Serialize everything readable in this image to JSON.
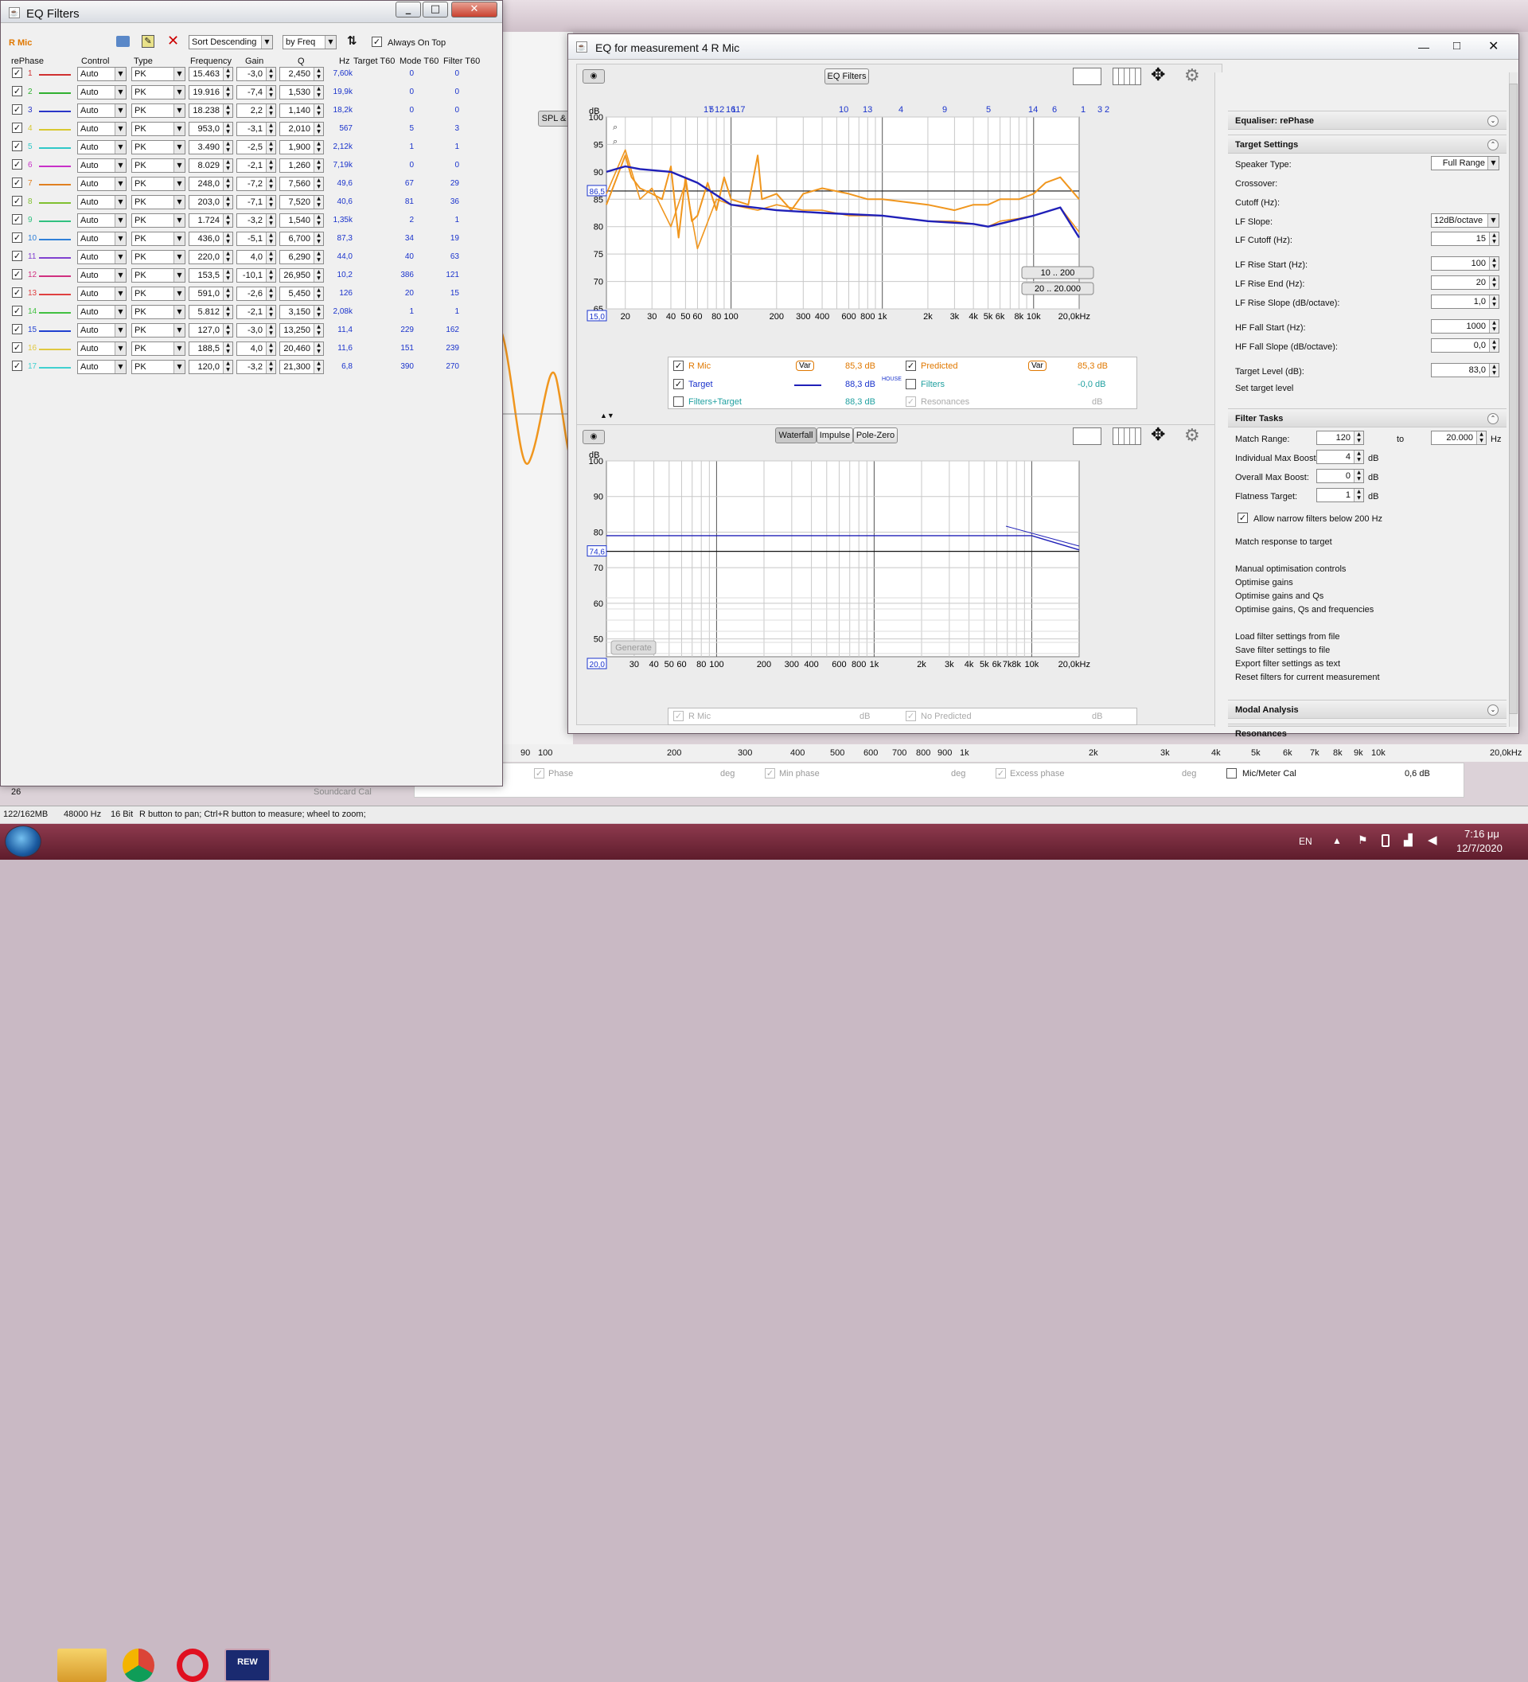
{
  "eq_filters": {
    "title": "EQ Filters",
    "measurement": "R Mic",
    "sort_select": "Sort Descending",
    "sort_by": "by Freq",
    "always_on_top": "Always On Top",
    "headers": {
      "filter": "rePhase",
      "control": "Control",
      "type": "Type",
      "frequency": "Frequency",
      "gain": "Gain",
      "q": "Q",
      "hz": "Hz",
      "target_t60": "Target T60",
      "mode_t60": "Mode T60",
      "filter_t60": "Filter T60"
    },
    "filters": [
      {
        "n": "1",
        "control": "Auto",
        "type": "PK",
        "freq": "15.463",
        "gain": "-3,0",
        "q": "2,450",
        "hz": "7,60k",
        "mode": "0",
        "filt": "0",
        "color": "#d03030"
      },
      {
        "n": "2",
        "control": "Auto",
        "type": "PK",
        "freq": "19.916",
        "gain": "-7,4",
        "q": "1,530",
        "hz": "19,9k",
        "mode": "0",
        "filt": "0",
        "color": "#30b030"
      },
      {
        "n": "3",
        "control": "Auto",
        "type": "PK",
        "freq": "18.238",
        "gain": "2,2",
        "q": "1,140",
        "hz": "18,2k",
        "mode": "0",
        "filt": "0",
        "color": "#2a36c8"
      },
      {
        "n": "4",
        "control": "Auto",
        "type": "PK",
        "freq": "953,0",
        "gain": "-3,1",
        "q": "2,010",
        "hz": "567",
        "mode": "5",
        "filt": "3",
        "color": "#d8c830"
      },
      {
        "n": "5",
        "control": "Auto",
        "type": "PK",
        "freq": "3.490",
        "gain": "-2,5",
        "q": "1,900",
        "hz": "2,12k",
        "mode": "1",
        "filt": "1",
        "color": "#30c8c8"
      },
      {
        "n": "6",
        "control": "Auto",
        "type": "PK",
        "freq": "8.029",
        "gain": "-2,1",
        "q": "1,260",
        "hz": "7,19k",
        "mode": "0",
        "filt": "0",
        "color": "#c830c8"
      },
      {
        "n": "7",
        "control": "Auto",
        "type": "PK",
        "freq": "248,0",
        "gain": "-7,2",
        "q": "7,560",
        "hz": "49,6",
        "mode": "67",
        "filt": "29",
        "color": "#e08020"
      },
      {
        "n": "8",
        "control": "Auto",
        "type": "PK",
        "freq": "203,0",
        "gain": "-7,1",
        "q": "7,520",
        "hz": "40,6",
        "mode": "81",
        "filt": "36",
        "color": "#80c030"
      },
      {
        "n": "9",
        "control": "Auto",
        "type": "PK",
        "freq": "1.724",
        "gain": "-3,2",
        "q": "1,540",
        "hz": "1,35k",
        "mode": "2",
        "filt": "1",
        "color": "#30c080"
      },
      {
        "n": "10",
        "control": "Auto",
        "type": "PK",
        "freq": "436,0",
        "gain": "-5,1",
        "q": "6,700",
        "hz": "87,3",
        "mode": "34",
        "filt": "19",
        "color": "#3080d8"
      },
      {
        "n": "11",
        "control": "Auto",
        "type": "PK",
        "freq": "220,0",
        "gain": "4,0",
        "q": "6,290",
        "hz": "44,0",
        "mode": "40",
        "filt": "63",
        "color": "#8040d0"
      },
      {
        "n": "12",
        "control": "Auto",
        "type": "PK",
        "freq": "153,5",
        "gain": "-10,1",
        "q": "26,950",
        "hz": "10,2",
        "mode": "386",
        "filt": "121",
        "color": "#d03080"
      },
      {
        "n": "13",
        "control": "Auto",
        "type": "PK",
        "freq": "591,0",
        "gain": "-2,6",
        "q": "5,450",
        "hz": "126",
        "mode": "20",
        "filt": "15",
        "color": "#e04040"
      },
      {
        "n": "14",
        "control": "Auto",
        "type": "PK",
        "freq": "5.812",
        "gain": "-2,1",
        "q": "3,150",
        "hz": "2,08k",
        "mode": "1",
        "filt": "1",
        "color": "#40c040"
      },
      {
        "n": "15",
        "control": "Auto",
        "type": "PK",
        "freq": "127,0",
        "gain": "-3,0",
        "q": "13,250",
        "hz": "11,4",
        "mode": "229",
        "filt": "162",
        "color": "#2040d0"
      },
      {
        "n": "16",
        "control": "Auto",
        "type": "PK",
        "freq": "188,5",
        "gain": "4,0",
        "q": "20,460",
        "hz": "11,6",
        "mode": "151",
        "filt": "239",
        "color": "#e0c840"
      },
      {
        "n": "17",
        "control": "Auto",
        "type": "PK",
        "freq": "120,0",
        "gain": "-3,2",
        "q": "21,300",
        "hz": "6,8",
        "mode": "390",
        "filt": "270",
        "color": "#40d0d0"
      }
    ]
  },
  "eq_window": {
    "title": "EQ for measurement 4 R Mic",
    "eq_filters_button": "EQ Filters",
    "top_axis_labels": [
      "17",
      "5",
      "12",
      "16",
      "117",
      "10",
      "13",
      "4",
      "9",
      "5",
      "14",
      "6",
      "1",
      "3",
      "2"
    ],
    "y_unit": "dB",
    "y_ticks": [
      "100",
      "95",
      "90",
      "85",
      "80",
      "75",
      "70",
      "65"
    ],
    "y_marker": "86,5",
    "x_start": "15,0",
    "x_ticks": [
      "20",
      "30",
      "40",
      "50",
      "60",
      "80",
      "100",
      "200",
      "300",
      "400",
      "600",
      "800",
      "1k",
      "2k",
      "3k",
      "4k",
      "5k",
      "6k",
      "8k",
      "10k",
      "20,0kHz"
    ],
    "range_buttons": [
      "10 .. 200",
      "20 .. 20.000"
    ],
    "legend": {
      "rmic": "R Mic",
      "rmic_var": "Var",
      "rmic_val": "85,3 dB",
      "predicted": "Predicted",
      "pred_var": "Var",
      "pred_val": "85,3 dB",
      "target": "Target",
      "target_val": "88,3 dB",
      "target_sup": "HOUSE",
      "filters": "Filters",
      "filters_val": "-0,0 dB",
      "filters_target": "Filters+Target",
      "ft_val": "88,3 dB",
      "resonances": "Resonances",
      "res_val": "dB"
    },
    "tabs": [
      "Waterfall",
      "Impulse",
      "Pole-Zero"
    ],
    "lower_y_unit": "dB",
    "lower_y_ticks": [
      "100",
      "90",
      "80",
      "70",
      "60",
      "50"
    ],
    "lower_marker": "74,6",
    "lower_x_start": "20,0",
    "lower_x_ticks": [
      "30",
      "40",
      "50",
      "60",
      "80",
      "100",
      "200",
      "300",
      "400",
      "600",
      "800",
      "1k",
      "2k",
      "3k",
      "4k",
      "5k",
      "6k",
      "7k",
      "8k",
      "10k",
      "20,0kHz"
    ],
    "generate": "Generate",
    "lower_legend": {
      "rmic": "R Mic",
      "rmic_val": "dB",
      "nopred": "No Predicted",
      "nopred_val": "dB"
    }
  },
  "settings": {
    "equaliser": "Equaliser: rePhase",
    "target_settings": "Target Settings",
    "speaker_type_label": "Speaker Type:",
    "speaker_type": "Full Range",
    "crossover_label": "Crossover:",
    "cutoff_label": "Cutoff (Hz):",
    "lf_slope_label": "LF Slope:",
    "lf_slope": "12dB/octave",
    "lf_cutoff_label": "LF Cutoff (Hz):",
    "lf_cutoff": "15",
    "lf_rise_start_label": "LF Rise Start (Hz):",
    "lf_rise_start": "100",
    "lf_rise_end_label": "LF Rise End (Hz):",
    "lf_rise_end": "20",
    "lf_rise_slope_label": "LF Rise Slope (dB/octave):",
    "lf_rise_slope": "1,0",
    "hf_fall_start_label": "HF Fall Start (Hz):",
    "hf_fall_start": "1000",
    "hf_fall_slope_label": "HF Fall Slope (dB/octave):",
    "hf_fall_slope": "0,0",
    "target_level_label": "Target Level (dB):",
    "target_level": "83,0",
    "set_target_level": "Set target level",
    "filter_tasks": "Filter Tasks",
    "match_range_label": "Match Range:",
    "match_from": "120",
    "match_to_label": "to",
    "match_to": "20.000",
    "hz": "Hz",
    "ind_max_boost_label": "Individual Max Boost:",
    "ind_max_boost": "4",
    "overall_max_boost_label": "Overall Max Boost:",
    "overall_max_boost": "0",
    "flatness_label": "Flatness Target:",
    "flatness": "1",
    "db": "dB",
    "allow_narrow": "Allow narrow filters below 200 Hz",
    "match_response": "Match response to target",
    "manual": "Manual optimisation controls",
    "opt_gains": "Optimise gains",
    "opt_gains_qs": "Optimise gains and Qs",
    "opt_all": "Optimise gains, Qs and frequencies",
    "load": "Load filter settings from file",
    "save": "Save filter settings to file",
    "export": "Export filter settings as text",
    "reset": "Reset filters for current measurement",
    "modal": "Modal Analysis",
    "resonances": "Resonances"
  },
  "background": {
    "spl_tab": "SPL &",
    "x_ticks": [
      "90",
      "100",
      "200",
      "300",
      "400",
      "500",
      "600",
      "700",
      "800",
      "900",
      "1k",
      "2k",
      "3k",
      "4k",
      "5k",
      "6k",
      "7k",
      "8k",
      "9k",
      "10k",
      "20,0kHz"
    ],
    "phase": "Phase",
    "deg": "deg",
    "min_phase": "Min phase",
    "excess_phase": "Excess phase",
    "mic_cal": "Mic/Meter Cal",
    "mic_cal_val": "0,6 dB",
    "soundcard_cal": "Soundcard Cal",
    "num": "26",
    "status_mem": "122/162MB",
    "status_rate": "48000 Hz",
    "status_bits": "16 Bit",
    "status_hint": "R button to pan; Ctrl+R button to measure; wheel to zoom;"
  },
  "taskbar": {
    "lang": "EN",
    "time": "7:16 μμ",
    "date": "12/7/2020",
    "rew": "REW"
  },
  "colors": {
    "orange": "#f0961e",
    "blue": "#2020b8",
    "label_blue": "#1a33cc",
    "taskbar": "#7a2a3c"
  },
  "chart_data": [
    {
      "type": "line",
      "title": "",
      "ylabel": "dB",
      "ylim": [
        65,
        100
      ],
      "xlim": [
        15,
        20000
      ],
      "xscale": "log",
      "series": [
        {
          "name": "R Mic",
          "x": [
            15,
            20,
            22,
            25,
            30,
            35,
            40,
            45,
            50,
            55,
            60,
            70,
            80,
            90,
            100,
            130,
            150,
            160,
            200,
            250,
            300,
            400,
            600,
            800,
            1000,
            2000,
            3000,
            4000,
            5000,
            6000,
            8000,
            10000,
            12000,
            15000,
            20000
          ],
          "y": [
            84,
            93,
            89,
            87,
            86,
            85,
            91,
            78,
            89,
            81,
            82,
            88,
            83,
            89,
            85,
            84,
            93,
            85,
            86,
            83,
            86,
            87,
            86,
            85,
            85,
            84,
            83,
            84,
            84,
            85,
            85,
            86,
            88,
            89,
            85
          ]
        },
        {
          "name": "Predicted",
          "x": [
            15,
            20,
            25,
            30,
            40,
            50,
            60,
            80,
            100,
            150,
            200,
            300,
            400,
            600,
            1000,
            2000,
            3000,
            4000,
            5000,
            6000,
            8000,
            10000,
            15000,
            20000
          ],
          "y": [
            86,
            94,
            85,
            87,
            80,
            88,
            76,
            85,
            84,
            83,
            84,
            83,
            83,
            82,
            82,
            81,
            81,
            80.5,
            80,
            81,
            81.5,
            82,
            83.5,
            79
          ]
        },
        {
          "name": "Target",
          "x": [
            15,
            20,
            25,
            40,
            60,
            100,
            200,
            400,
            1000,
            2000,
            4000,
            5000,
            10000,
            15000,
            20000
          ],
          "y": [
            90,
            91,
            90.5,
            90,
            88,
            84,
            83,
            82.5,
            82,
            81,
            80.5,
            80,
            82,
            83.5,
            78
          ]
        }
      ]
    },
    {
      "type": "line",
      "title": "",
      "ylabel": "dB",
      "ylim": [
        45,
        100
      ],
      "xlim": [
        20,
        20000
      ],
      "xscale": "log",
      "series": [
        {
          "name": "",
          "x": [
            20,
            1000,
            5000,
            10000,
            20000
          ],
          "y": [
            79,
            79,
            79,
            79,
            75
          ]
        }
      ]
    }
  ]
}
